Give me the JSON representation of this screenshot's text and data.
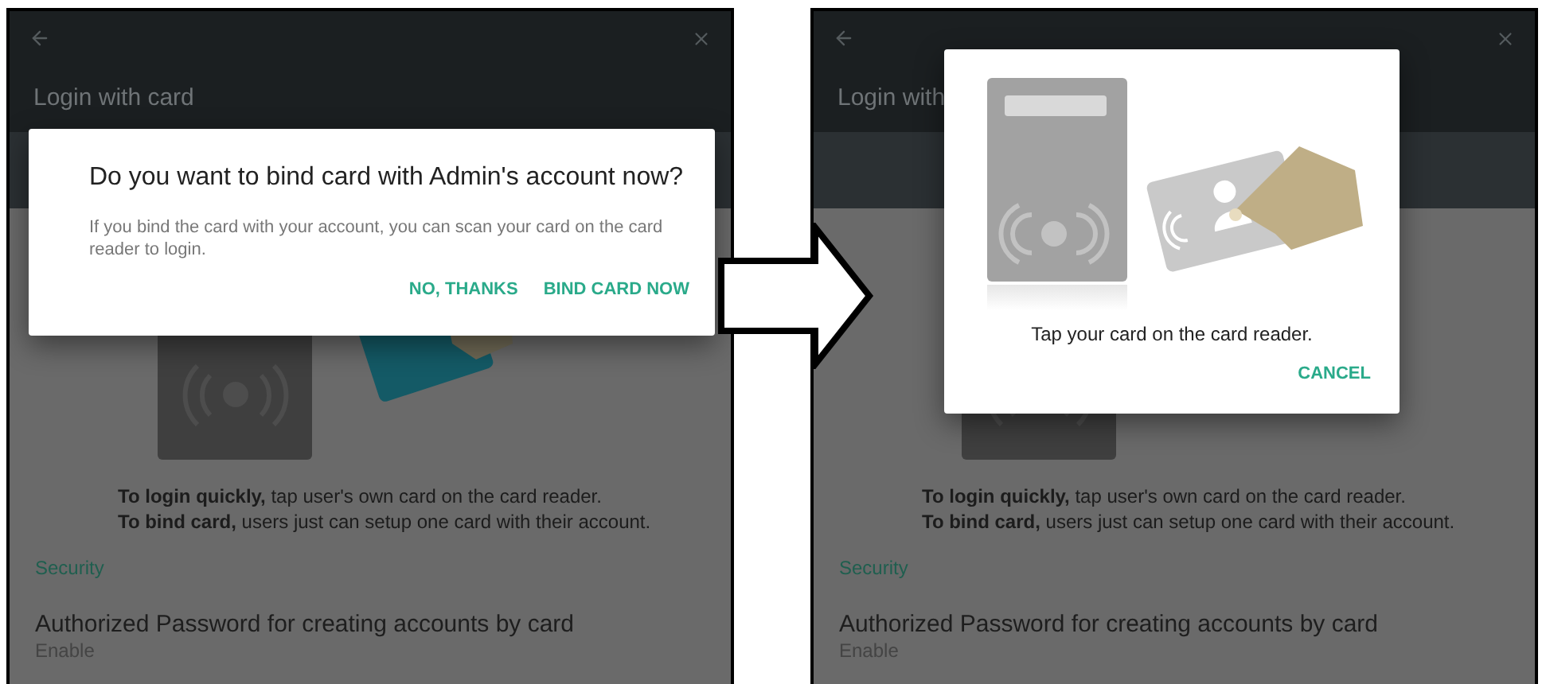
{
  "panels": [
    {
      "title": "Login with card",
      "description": [
        "**To login quickly,** tap user's own card on the card reader.",
        "**To bind card,** users just can setup one card with their account."
      ],
      "section": "Security",
      "setting": {
        "label": "Authorized Password for creating accounts by card",
        "value": "Enable"
      },
      "dialog": {
        "kind": "confirm",
        "title": "Do you want to bind card with Admin's account now?",
        "message": "If you bind the card with your account, you can scan your card on the card reader to login.",
        "actions": [
          "NO, THANKS",
          "BIND CARD NOW"
        ]
      }
    },
    {
      "title": "Login with",
      "description": [
        "**To login quickly,** tap user's own card on the card reader.",
        "**To bind card,** users just can setup one card with their account."
      ],
      "section": "Security",
      "setting": {
        "label": "Authorized Password for creating accounts by card",
        "value": "Enable"
      },
      "dialog": {
        "kind": "scan",
        "message": "Tap your card on the card reader.",
        "actions": [
          "CANCEL"
        ]
      }
    }
  ]
}
